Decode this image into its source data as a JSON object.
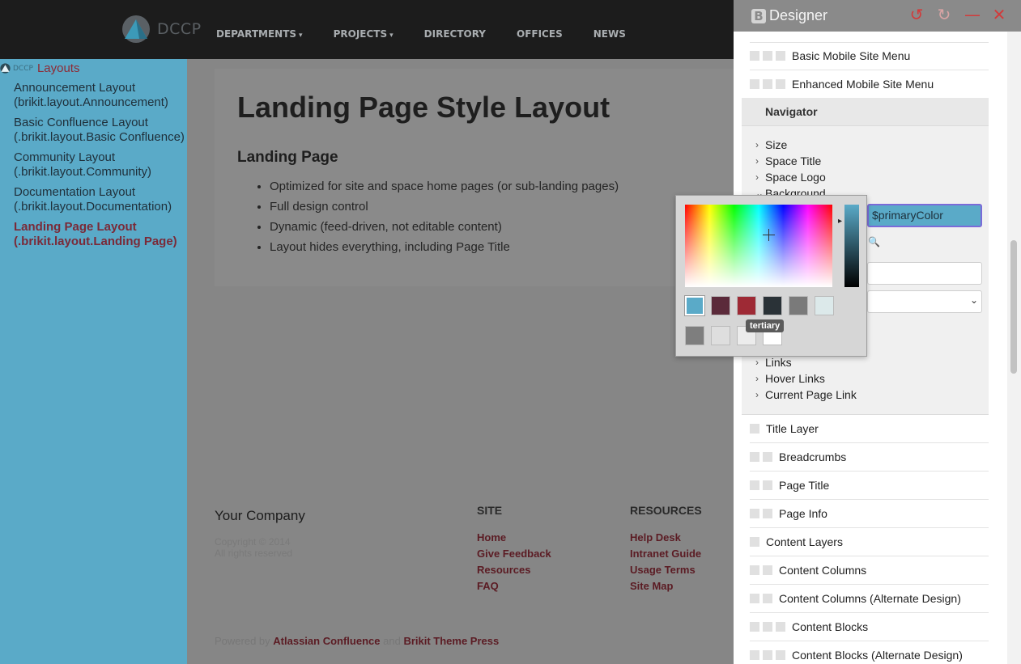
{
  "header": {
    "logo_text": "DCCP",
    "nav": [
      {
        "label": "DEPARTMENTS",
        "caret": "▾"
      },
      {
        "label": "PROJECTS",
        "caret": "▾"
      },
      {
        "label": "DIRECTORY"
      },
      {
        "label": "OFFICES"
      },
      {
        "label": "NEWS"
      }
    ]
  },
  "sidebar": {
    "mini_logo": "DCCP",
    "title": "Layouts",
    "items": [
      {
        "label": "Announcement Layout (brikit.layout.Announcement)"
      },
      {
        "label": "Basic Confluence Layout (.brikit.layout.Basic Confluence)"
      },
      {
        "label": "Community Layout (.brikit.layout.Community)"
      },
      {
        "label": "Documentation Layout (.brikit.layout.Documentation)"
      },
      {
        "label": "Landing Page Layout (.brikit.layout.Landing Page)",
        "active": true
      }
    ]
  },
  "main": {
    "title": "Landing Page Style Layout",
    "subtitle": "Landing Page",
    "bullets": [
      "Optimized for site and space home pages (or sub-landing pages)",
      "Full design control",
      "Dynamic (feed-driven, not editable content)",
      "Layout hides everything, including Page Title"
    ]
  },
  "footer": {
    "company": "Your Company",
    "copyright": "Copyright © 2014",
    "rights": "All rights reserved",
    "site": {
      "heading": "SITE",
      "links": [
        "Home",
        "Give Feedback",
        "Resources",
        "FAQ"
      ]
    },
    "resources": {
      "heading": "RESOURCES",
      "links": [
        "Help Desk",
        "Intranet Guide",
        "Usage Terms",
        "Site Map"
      ]
    },
    "powered_prefix": "Powered by",
    "powered_link1": "Atlassian Confluence",
    "powered_and": "and",
    "powered_link2": "Brikit Theme Press"
  },
  "designer": {
    "brand_letter": "B",
    "title": "Designer",
    "tools": {
      "undo": "↺",
      "redo": "↻",
      "minimize": "—",
      "close": "✕"
    },
    "top_rows": [
      {
        "label": "Basic Mobile Site Menu",
        "boxes": 3
      },
      {
        "label": "Enhanced Mobile Site Menu",
        "boxes": 3
      }
    ],
    "navigator": {
      "title": "Navigator",
      "properties_top": [
        {
          "label": "Size",
          "chev": "›"
        },
        {
          "label": "Space Title",
          "chev": "›"
        },
        {
          "label": "Space Logo",
          "chev": "›"
        },
        {
          "label": "Background",
          "chev": "⌄"
        }
      ],
      "primary_value": "$primaryColor",
      "search_icon": "🔍",
      "select_arrow": "⌄",
      "properties_bottom": [
        {
          "label": "Links",
          "chev": "›"
        },
        {
          "label": "Hover Links",
          "chev": "›"
        },
        {
          "label": "Current Page Link",
          "chev": "›"
        }
      ]
    },
    "bottom_rows": [
      {
        "label": "Title Layer",
        "boxes": 1
      },
      {
        "label": "Breadcrumbs",
        "boxes": 2
      },
      {
        "label": "Page Title",
        "boxes": 2
      },
      {
        "label": "Page Info",
        "boxes": 2
      },
      {
        "label": "Content Layers",
        "boxes": 1
      },
      {
        "label": "Content Columns",
        "boxes": 2
      },
      {
        "label": "Content Columns (Alternate Design)",
        "boxes": 2
      },
      {
        "label": "Content Blocks",
        "boxes": 3
      },
      {
        "label": "Content Blocks (Alternate Design)",
        "boxes": 3
      }
    ]
  },
  "color_picker": {
    "tooltip": "tertiary",
    "hue_arrow": "▸",
    "swatches_row1": [
      "#5aaac8",
      "#5b2a3a",
      "#9e2a35",
      "#2a3237",
      "#7a7a7a",
      "#dce9ea"
    ],
    "swatches_row2": [
      "#7e7e7e",
      "#dedede",
      "#ececec",
      "#ffffff"
    ],
    "selected_index": 0
  },
  "colors": {
    "accent_blue": "#5aaac8",
    "brand_maroon": "#8e2a35",
    "header_bg": "#1c1c1c",
    "designer_header": "#8a8a8a"
  }
}
